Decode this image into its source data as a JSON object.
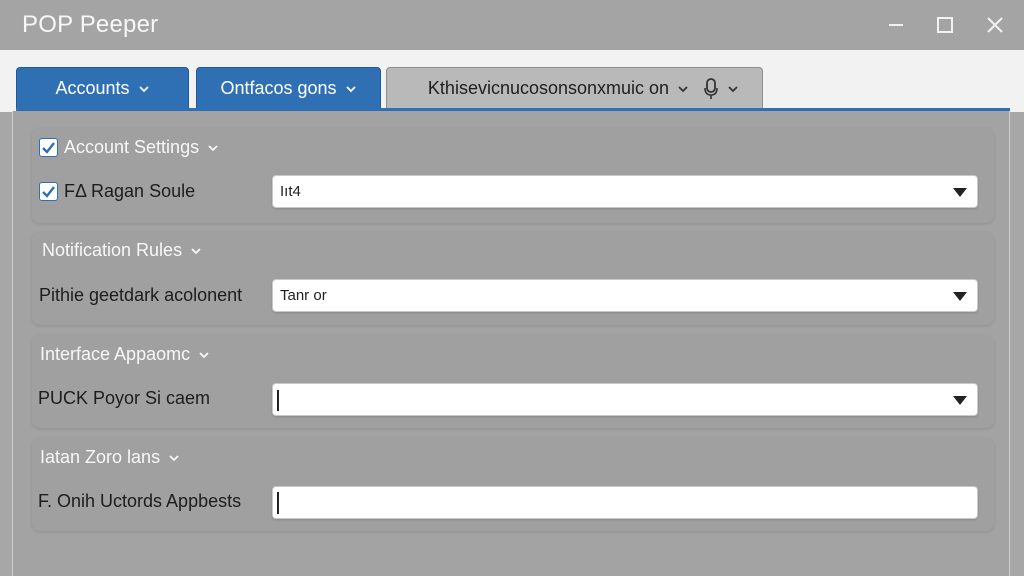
{
  "window": {
    "title": "POP Peeper"
  },
  "tabs": [
    {
      "label": "Accounts"
    },
    {
      "label": "Ontfacos gons"
    },
    {
      "label": "Kthisevicnucosonsonxmuic on"
    }
  ],
  "sections": [
    {
      "title": "Account Settings",
      "row_label": "FΔ Ragan Soule",
      "value": "Iıt4"
    },
    {
      "title": "Notification Rules",
      "row_label": "Pithie geetdark acolonent",
      "value": "Tanr or"
    },
    {
      "title": "Interface Appaomc",
      "row_label": "PUCK Poyor Si caem",
      "value": ""
    },
    {
      "title": "Iatan Zoro lans",
      "row_label": "F. Onih Uctords Appbests",
      "value": ""
    }
  ],
  "colors": {
    "accent": "#2f6fb4",
    "titlebar": "#a4a4a4",
    "panel": "#a0a0a0"
  }
}
